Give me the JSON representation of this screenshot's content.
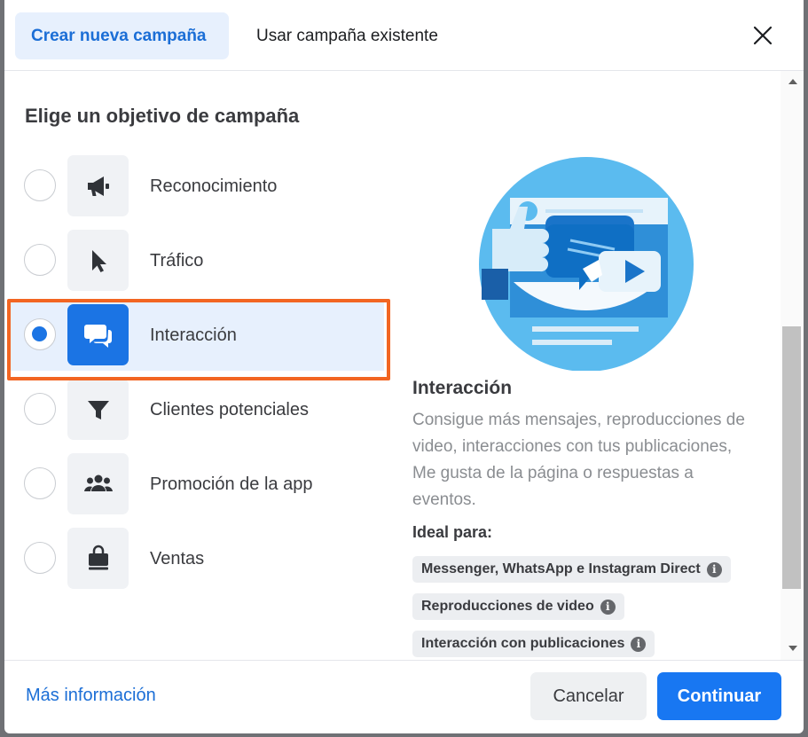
{
  "tabs": {
    "new_campaign": "Crear nueva campaña",
    "existing_campaign": "Usar campaña existente"
  },
  "section_title": "Elige un objetivo de campaña",
  "objectives": [
    {
      "label": "Reconocimiento",
      "icon": "megaphone-icon",
      "selected": false
    },
    {
      "label": "Tráfico",
      "icon": "cursor-icon",
      "selected": false
    },
    {
      "label": "Interacción",
      "icon": "chat-bubbles-icon",
      "selected": true
    },
    {
      "label": "Clientes potenciales",
      "icon": "funnel-icon",
      "selected": false
    },
    {
      "label": "Promoción de la app",
      "icon": "people-icon",
      "selected": false
    },
    {
      "label": "Ventas",
      "icon": "shopping-bag-icon",
      "selected": false
    }
  ],
  "detail": {
    "title": "Interacción",
    "description": "Consigue más mensajes, reproducciones de video, interacciones con tus publicaciones, Me gusta de la página o respuestas a eventos.",
    "ideal_title": "Ideal para:",
    "ideal_for": [
      "Messenger, WhatsApp e Instagram Direct",
      "Reproducciones de video",
      "Interacción con publicaciones"
    ]
  },
  "footer": {
    "more_info": "Más información",
    "cancel": "Cancelar",
    "continue": "Continuar"
  },
  "colors": {
    "accent": "#1877f2",
    "tab_active_bg": "#e7f0fd",
    "highlight_outline": "#f26522"
  }
}
